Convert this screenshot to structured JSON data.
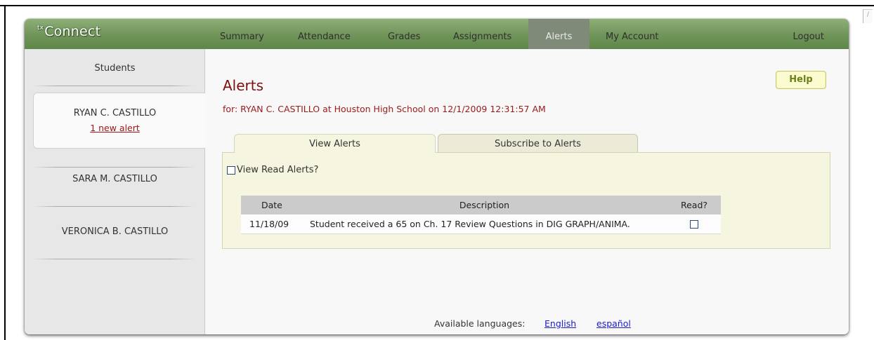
{
  "app": {
    "logo_prefix": "tx",
    "logo_text": "Connect"
  },
  "nav": {
    "items": [
      {
        "label": "Summary"
      },
      {
        "label": "Attendance"
      },
      {
        "label": "Grades"
      },
      {
        "label": "Assignments"
      },
      {
        "label": "Alerts",
        "active": true
      },
      {
        "label": "My Account"
      }
    ],
    "logout_label": "Logout"
  },
  "sidebar": {
    "title": "Students",
    "students": [
      {
        "name": "RYAN C. CASTILLO",
        "alert": "1 new alert",
        "selected": true
      },
      {
        "name": "SARA M. CASTILLO"
      },
      {
        "name": "VERONICA B. CASTILLO"
      }
    ]
  },
  "main": {
    "help_label": "Help",
    "title": "Alerts",
    "subtitle": "for: RYAN C. CASTILLO at Houston High School on 12/1/2009 12:31:57 AM",
    "tabs": [
      {
        "label": "View Alerts",
        "active": true
      },
      {
        "label": "Subscribe to Alerts"
      }
    ],
    "view_read_label": "View Read Alerts?",
    "view_read_checked": false,
    "table": {
      "headers": {
        "date": "Date",
        "description": "Description",
        "read": "Read?"
      },
      "rows": [
        {
          "date": "11/18/09",
          "description": "Student received a 65 on Ch. 17 Review Questions in DIG GRAPH/ANIMA.",
          "read": false
        }
      ]
    },
    "languages": {
      "label": "Available languages:",
      "options": [
        "English",
        "español"
      ]
    }
  },
  "colors": {
    "nav_bar": "#6f9459",
    "nav_active": "#7f8a79",
    "title_red": "#7a1010",
    "link_blue": "#1a1ad0",
    "tab_panel": "#f6f6e0"
  }
}
